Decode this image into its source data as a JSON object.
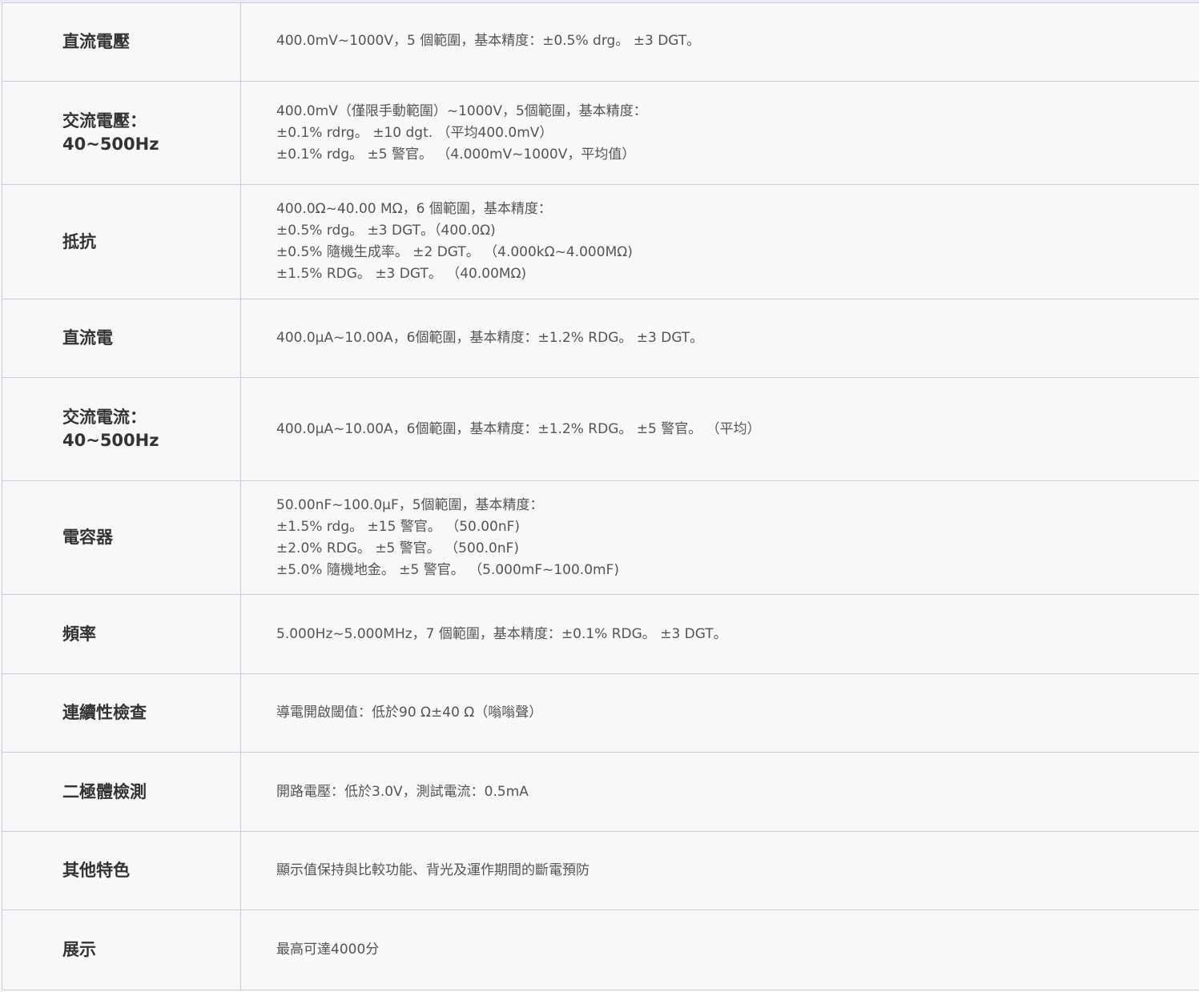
{
  "spec_table": {
    "rows": [
      {
        "label": [
          "直流電壓"
        ],
        "lines": [
          "400.0mV~1000V，5 個範圍，基本精度：±0.5% drg。 ±3 DGT。"
        ]
      },
      {
        "label": [
          "交流電壓：",
          "40~500Hz"
        ],
        "lines": [
          "400.0mV（僅限手動範圍）~1000V，5個範圍，基本精度：",
          "±0.1% rdrg。 ±10 dgt. （平均400.0mV）",
          "±0.1% rdg。 ±5 警官。 （4.000mV~1000V，平均值）"
        ]
      },
      {
        "label": [
          "抵抗"
        ],
        "lines": [
          "400.0Ω~40.00 MΩ，6 個範圍，基本精度：",
          "±0.5% rdg。 ±3 DGT。（400.0Ω)",
          "±0.5% 隨機生成率。 ±2 DGT。 （4.000kΩ~4.000MΩ)",
          "±1.5% RDG。 ±3 DGT。 （40.00MΩ)"
        ]
      },
      {
        "label": [
          "直流電"
        ],
        "lines": [
          "400.0μA~10.00A，6個範圍，基本精度：±1.2% RDG。 ±3 DGT。"
        ]
      },
      {
        "label": [
          "交流電流：",
          "40~500Hz"
        ],
        "lines": [
          "400.0μA~10.00A，6個範圍，基本精度：±1.2% RDG。 ±5 警官。 （平均）"
        ]
      },
      {
        "label": [
          "電容器"
        ],
        "lines": [
          "50.00nF~100.0μF，5個範圍，基本精度：",
          "±1.5% rdg。 ±15 警官。 （50.00nF)",
          "±2.0% RDG。 ±5 警官。 （500.0nF)",
          "±5.0% 隨機地金。 ±5 警官。 （5.000mF~100.0mF)"
        ]
      },
      {
        "label": [
          "頻率"
        ],
        "lines": [
          "5.000Hz~5.000MHz，7 個範圍，基本精度：±0.1% RDG。 ±3 DGT。"
        ]
      },
      {
        "label": [
          "連續性檢查"
        ],
        "lines": [
          "導電開啟閾值：低於90 Ω±40 Ω（嗡嗡聲）"
        ]
      },
      {
        "label": [
          "二極體檢測"
        ],
        "lines": [
          "開路電壓：低於3.0V，測試電流：0.5mA"
        ]
      },
      {
        "label": [
          "其他特色"
        ],
        "lines": [
          "顯示值保持與比較功能、背光及運作期間的斷電預防"
        ]
      },
      {
        "label": [
          "展示"
        ],
        "lines": [
          "最高可達4000分"
        ]
      }
    ]
  }
}
